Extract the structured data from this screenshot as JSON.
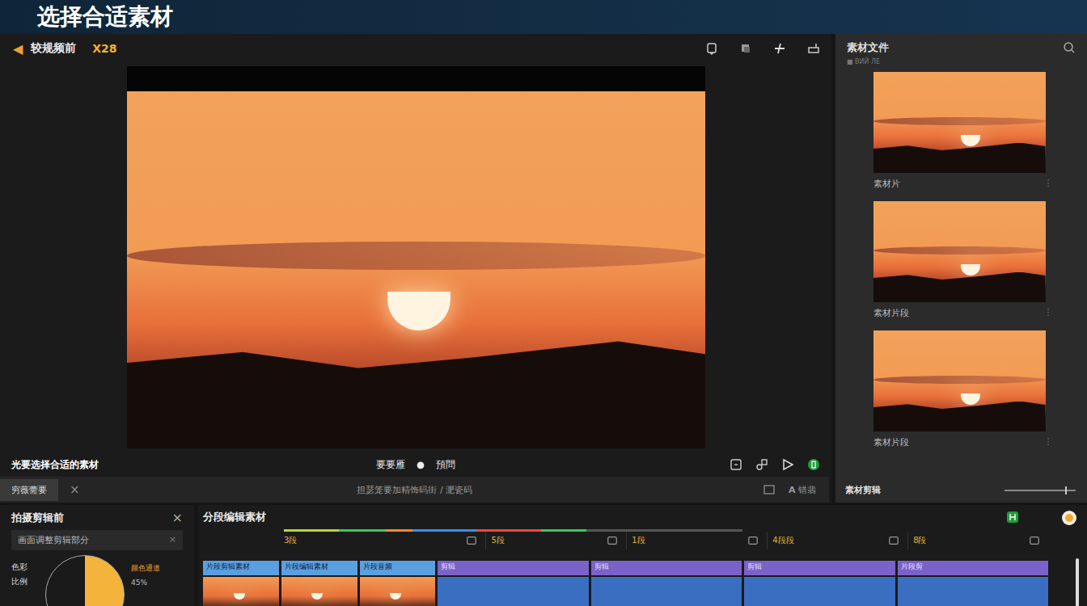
{
  "banner": {
    "title": "选择合适素材"
  },
  "toolbar": {
    "back_icon": "◀",
    "title": "较规频前",
    "code": "X28"
  },
  "preview": {
    "caption": "光要选择合适的素材",
    "center_left": "要要雁",
    "center_right": "預問"
  },
  "subbar": {
    "tab": {
      "label": "穷薇薷要",
      "selected": true
    },
    "close": "×",
    "info": "担瑟笼要加精饰码街 / 淝瓷码",
    "action_icon": "A",
    "action": "错翡"
  },
  "assets": {
    "title": "素材文件",
    "subtitle": "■ ВИЙ ЛЕ",
    "items": [
      {
        "label": "素材片"
      },
      {
        "label": "素材片段"
      },
      {
        "label": "素材片段"
      }
    ],
    "footer": "素材剪辑",
    "zoom_level": 0.85
  },
  "edit_panel": {
    "title": "拍摄剪辑前",
    "close": "×",
    "row": "画面调整剪辑部分",
    "row_close": "×",
    "chart_level": 0.5,
    "labels": [
      "色彩",
      "比例"
    ],
    "value_label": "颜色通道",
    "value": "45%"
  },
  "timeline": {
    "title": "分段编辑素材",
    "tracks": [
      {
        "label": "3段"
      },
      {
        "label": "5段"
      },
      {
        "label": "1段"
      },
      {
        "label": "4段段"
      },
      {
        "label": "8段"
      }
    ],
    "progress": [
      {
        "color": "#b8d43a",
        "share": 0.12
      },
      {
        "color": "#3cc85a",
        "share": 0.1
      },
      {
        "color": "#f08a2a",
        "share": 0.06
      },
      {
        "color": "#3a8ee8",
        "share": 0.14
      },
      {
        "color": "#e84a3a",
        "share": 0.14
      },
      {
        "color": "#3cc85a",
        "share": 0.1
      }
    ],
    "clips": [
      {
        "label": "片段剪辑素材",
        "kind": "video"
      },
      {
        "label": "片段编辑素材",
        "kind": "video"
      },
      {
        "label": "片段音频",
        "kind": "video"
      },
      {
        "label": "剪辑",
        "kind": "audio"
      },
      {
        "label": "剪辑",
        "kind": "audio"
      },
      {
        "label": "剪辑",
        "kind": "audio"
      },
      {
        "label": "片段剪",
        "kind": "audio"
      }
    ]
  }
}
